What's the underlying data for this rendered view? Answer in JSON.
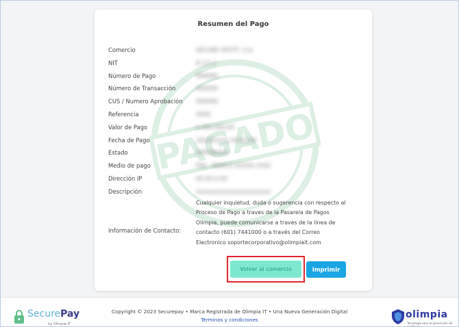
{
  "card": {
    "title": "Resumen del Pago",
    "stamp_text": "PAGADO",
    "fields": [
      {
        "label": "Comercio",
        "value": "SECURE SPOTT, S.A."
      },
      {
        "label": "NIT",
        "value": "8.1/1.2"
      },
      {
        "label": "Número de Pago",
        "value": "999999"
      },
      {
        "label": "Número de Transacción",
        "value": "000000"
      },
      {
        "label": "CUS / Numero Aprobación",
        "value": "000000"
      },
      {
        "label": "Referencia",
        "value": "0000"
      },
      {
        "label": "Valor de Pago",
        "value": "$ 000.000,00"
      },
      {
        "label": "Fecha de Pago",
        "value": "2023/01/01 00:00:00"
      },
      {
        "label": "Estado",
        "value": "APROBADA"
      },
      {
        "label": "Medio de pago",
        "value": "PSE - BANCO XXXXX (XXXXX)"
      },
      {
        "label": "Dirección IP",
        "value": "00.00.0.00"
      },
      {
        "label": "Descripción",
        "value": "xxxxxxxxxxxxxxxxxxxxxx"
      }
    ],
    "contact_label": "Información de Contacto:",
    "contact_lines": [
      "Cualquier inquietud, duda o sugerencia con respecto al",
      "Proceso de Pago a traves de la Pasarela de Pagos",
      "Olimpia, puede comunicarse a traves de la línea de",
      "contacto (601) 7441000 o a través del Correo",
      "Electronico soportecorporativo@olimpiait.com"
    ],
    "back_button": "Volver al comercio",
    "print_button": "Imprimir"
  },
  "footer": {
    "copyright": "Copyright © 2023 Securepay • Marca Registrada de Olimpia IT • Una Nueva Generación Digital",
    "terms": "Términos y condiciones",
    "securepay_logo": {
      "part1": "Secure",
      "part2": "Pay",
      "sub": "by Olimpia IT"
    },
    "olimpia_logo": {
      "name": "olimpia",
      "sub": "Tecnología para la generación de confianza"
    }
  },
  "colors": {
    "back_button_bg": "#7de8cf",
    "print_button_bg": "#1aa6e4",
    "highlight_border": "#e0252b",
    "stamp": "#2e9e57"
  },
  "icons": [
    "padlock-icon",
    "shield-icon"
  ]
}
